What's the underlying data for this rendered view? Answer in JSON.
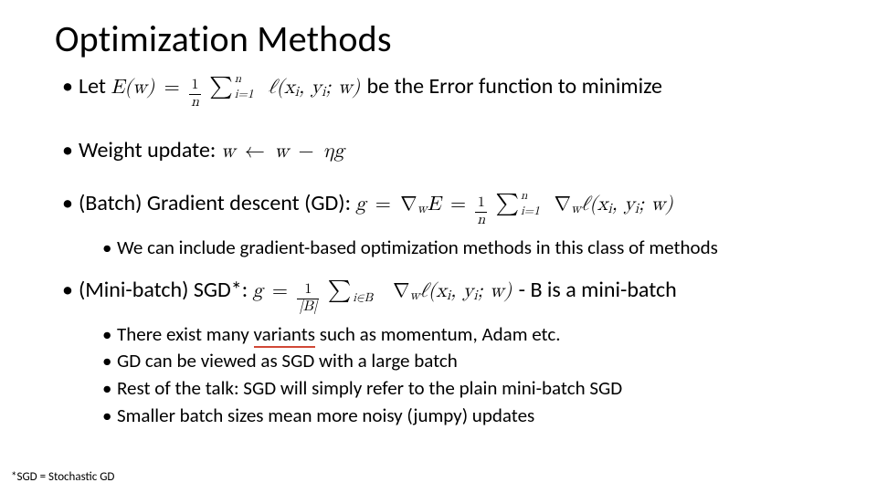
{
  "title": "Optimization Methods",
  "items": {
    "let": {
      "pre": "Let ",
      "post": " be the Error function to minimize"
    },
    "weight": {
      "label": "Weight update: "
    },
    "gd": {
      "label": "(Batch) Gradient descent (GD): ",
      "sub": "We can include gradient-based optimization methods in this class of methods"
    },
    "sgd": {
      "label": "(Mini-batch) SGD*: ",
      "post": " - B is a mini-batch",
      "subs": {
        "s1a": "There exist many ",
        "s1b": "variants",
        "s1c": " such as momentum, Adam etc.",
        "s2": "GD can be viewed as SGD with a large batch",
        "s3": "Rest of the talk: SGD will simply refer to the plain mini-batch SGD",
        "s4": "Smaller batch sizes mean more noisy (jumpy) updates"
      }
    }
  },
  "math": {
    "Ew": "E(w)",
    "eq": "=",
    "frac1n_num": "1",
    "frac1n_den": "n",
    "sum_lo": "i=1",
    "sum_hi": "n",
    "ell": "ℓ(x",
    "i": "i",
    "comma_y": ", y",
    "close_w": "; w)",
    "wupdate_w": "w",
    "wupdate_arrow": "←",
    "wupdate_rhs1": "w",
    "wupdate_rhs2": "−",
    "wupdate_rhs3": "ηg",
    "g": "g",
    "nabla_wE": "∇",
    "wE_sub": "w",
    "E": "E",
    "nabla_w_ell": "∇",
    "frac1B_num": "1",
    "frac1B_den": "|B|",
    "sumB_lo": "i∈B"
  },
  "footnote": "*SGD = Stochastic GD"
}
